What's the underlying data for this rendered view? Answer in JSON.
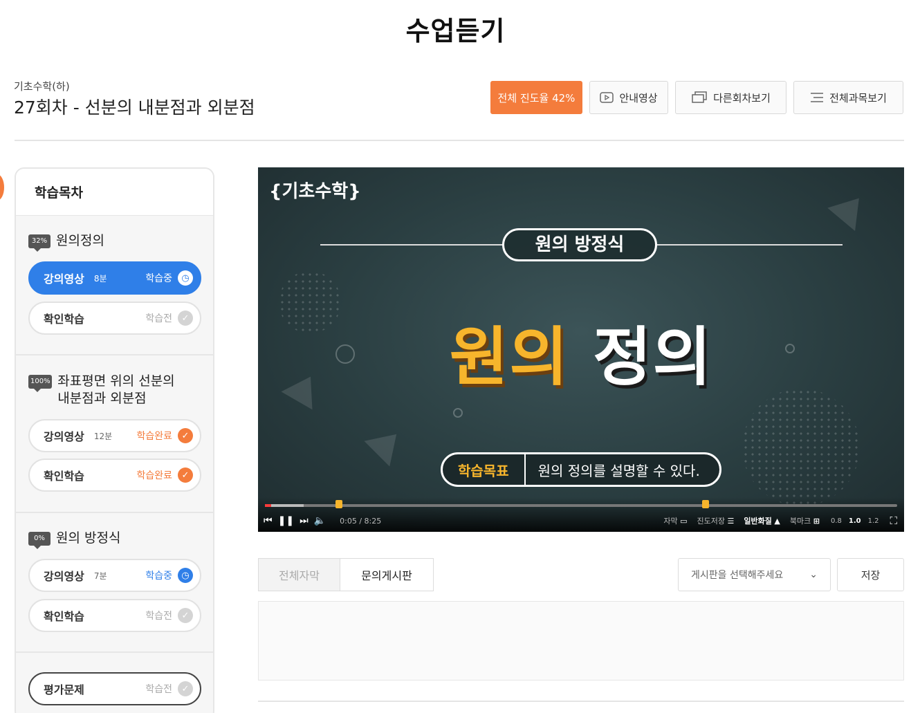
{
  "page": {
    "title": "수업듣기"
  },
  "course": {
    "subject": "기초수학(하)",
    "lesson_title": "27회차 - 선분의 내분점과 외분점"
  },
  "header_buttons": {
    "progress": "전체 진도율 42%",
    "guide": "안내영상",
    "other_lessons": "다른회차보기",
    "all_subjects": "전체과목보기"
  },
  "sidebar": {
    "title": "학습목차",
    "sections": [
      {
        "percent": "32%",
        "title": "원의정의",
        "items": [
          {
            "label": "강의영상",
            "duration": "8분",
            "status": "학습중",
            "icon": "clock-icon"
          },
          {
            "label": "확인학습",
            "duration": "",
            "status": "학습전",
            "icon": "check-icon"
          }
        ]
      },
      {
        "percent": "100%",
        "title": "좌표평면 위의 선분의 내분점과 외분점",
        "items": [
          {
            "label": "강의영상",
            "duration": "12분",
            "status": "학습완료",
            "icon": "check-icon"
          },
          {
            "label": "확인학습",
            "duration": "",
            "status": "학습완료",
            "icon": "check-icon"
          }
        ]
      },
      {
        "percent": "0%",
        "title": "원의 방정식",
        "items": [
          {
            "label": "강의영상",
            "duration": "7분",
            "status": "학습중",
            "icon": "clock-icon"
          },
          {
            "label": "확인학습",
            "duration": "",
            "status": "학습전",
            "icon": "check-icon"
          }
        ]
      }
    ],
    "evaluation": {
      "label": "평가문제",
      "status": "학습전",
      "icon": "check-icon"
    }
  },
  "video": {
    "logo": "기초수학",
    "topic": "원의 방정식",
    "main_part1": "원의",
    "main_part2": "정의",
    "goal_tag": "학습목표",
    "goal_text": "원의 정의를 설명할 수 있다.",
    "time": "0:05 / 8:25",
    "played_fraction": 0.01,
    "controls": {
      "subtitle": "자막",
      "save_progress": "진도저장",
      "quality": "일반화질",
      "bookmark": "북마크",
      "speeds": [
        "0.8",
        "1.0",
        "1.2"
      ],
      "selected_speed": "1.0"
    }
  },
  "tabs": {
    "subtitles": "전체자막",
    "qna": "문의게시판"
  },
  "board_select": {
    "placeholder": "게시판을 선택해주세요"
  },
  "save_label": "저장",
  "colors": {
    "accent": "#f47c3c",
    "active_blue": "#2f7fe8",
    "video_yellow": "#f7b52c"
  }
}
